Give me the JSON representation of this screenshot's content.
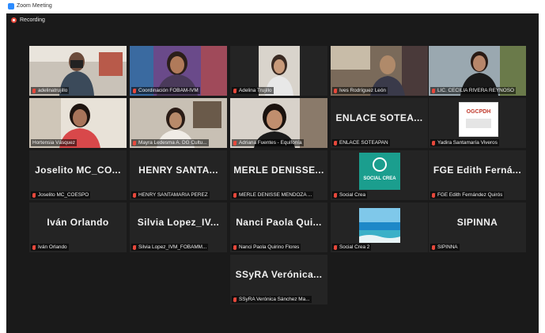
{
  "window": {
    "title": "Zoom Meeting"
  },
  "recording": {
    "label": "Recording"
  },
  "participants": [
    {
      "label": "adelinatrujillo"
    },
    {
      "label": "Coordinación FOBAM-IVM"
    },
    {
      "label": "Adelina Trujillo"
    },
    {
      "label": "Ives Rodríguez León"
    },
    {
      "label": "LIC. CECILIA RIVERA REYNOSO"
    },
    {
      "label": "Hortensia Vásquez"
    },
    {
      "label": "Mayra Ledesma A. DG Cultu..."
    },
    {
      "label": "Adriana Fuentes - Equifonía"
    },
    {
      "display": "ENLACE SOTEA...",
      "label": "ENLACE SOTEAPAN"
    },
    {
      "logo": "OGCPDH",
      "label": "Yadira Santamaría Viveros"
    },
    {
      "display": "Joselito MC_CO...",
      "label": "Joselito MC_COESPO"
    },
    {
      "display": "HENRY SANTA...",
      "label": "HENRY SANTAMARIA PEREZ"
    },
    {
      "display": "MERLE DENISSE...",
      "label": "MERLE DENISSE MENDOZA ..."
    },
    {
      "logo": "SOCIAL CREA",
      "label": "Social Crea"
    },
    {
      "display": "FGE Edith Ferná...",
      "label": "FGE Edith Fernández Quirós"
    },
    {
      "display": "Iván Orlando",
      "label": "Iván Orlando"
    },
    {
      "display": "Silvia Lopez_IV...",
      "label": "Silvia Lopez_IVM_FOBAMM..."
    },
    {
      "display": "Nanci Paola Qui...",
      "label": "Nanci Paola Quirino Flores"
    },
    {
      "label": "Social Crea 2"
    },
    {
      "display": "SIPINNA",
      "label": "SIPINNA"
    },
    {
      "display": "SSyRA Verónica...",
      "label": "SSyRA Verónica Sánchez Ma..."
    }
  ],
  "colors": {
    "active_speaker": "#b5d335",
    "muted": "#e8483b",
    "tile": "#242424"
  }
}
